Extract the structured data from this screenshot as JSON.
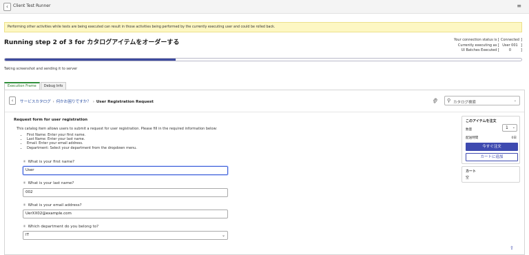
{
  "header": {
    "back_icon": "chevron-left-icon",
    "title": "Client Test Runner",
    "menu_icon": "hamburger-menu-icon"
  },
  "warning": {
    "text": "Performing other activities while tests are being executed can result in those activities being performed by the currently executing user and could be rolled back."
  },
  "run": {
    "prefix": "Running step ",
    "step": "2",
    "of_text": " of ",
    "total": "3",
    "for_text": " for ",
    "item_name": "カタログアイテムをオーダーする",
    "progress_fraction": 0.33,
    "sub_status": "Taking screenshot and sending it to server"
  },
  "status": {
    "connection_label": "Your connection status is",
    "connection_value": "Connected",
    "executing_label": "Currently executing as",
    "executing_value": "User 001",
    "batches_label": "UI Batches Executed",
    "batches_value": "0"
  },
  "tabs": [
    {
      "label": "Execution Frame"
    },
    {
      "label": "Debug Info"
    }
  ],
  "breadcrumb": {
    "items": [
      "サービスカタログ",
      "何かお困りですか？"
    ],
    "current": "User Registration Request",
    "separator": "›"
  },
  "catalog_search": {
    "placeholder": "カタログ検索"
  },
  "form": {
    "title": "Request form for user registration",
    "description": "This catalog item allows users to submit a request for user registration. Please fill in the required information below:",
    "bullets": [
      "First Name: Enter your first name.",
      "Last Name: Enter your last name.",
      "Email: Enter your email address.",
      "Department: Select your department from the dropdown menu."
    ],
    "questions": [
      {
        "label": "What is your first name?",
        "value": "User"
      },
      {
        "label": "What is your last name?",
        "value": "002"
      },
      {
        "label": "What is your email address?",
        "value": "UerXX02@example.com"
      },
      {
        "label": "Which department do you belong to?",
        "value": "IT"
      }
    ],
    "required_mark": "✳"
  },
  "order_panel": {
    "title": "このアイテムを注文",
    "quantity_label": "数量",
    "quantity_value": "1",
    "delivery_label": "配送時間",
    "delivery_value": "0日",
    "order_button": "今すぐ注文",
    "cart_button": "カートに追加"
  },
  "cart_panel": {
    "title": "カート",
    "empty_text": "空"
  },
  "colors": {
    "accent": "#3e4ab0",
    "warning_bg": "#fdf7c3",
    "tab_active": "#2f8f3a"
  }
}
